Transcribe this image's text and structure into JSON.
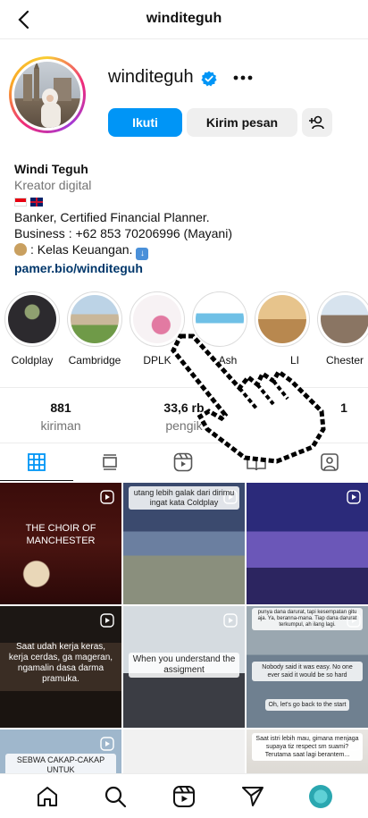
{
  "header": {
    "title": "winditeguh"
  },
  "profile": {
    "username": "winditeguh",
    "follow_label": "Ikuti",
    "message_label": "Kirim pesan",
    "name": "Windi Teguh",
    "category": "Kreator digital",
    "bio_line1": "Banker, Certified Financial Planner.",
    "bio_line2": "Business : +62 853 70206996 (Mayani)",
    "bio_line3": ": Kelas Keuangan.",
    "link": "pamer.bio/winditeguh"
  },
  "highlights": [
    {
      "label": "Coldplay"
    },
    {
      "label": "Cambridge"
    },
    {
      "label": "DPLK"
    },
    {
      "label": "Ash"
    },
    {
      "label": "LI"
    },
    {
      "label": "Chester"
    }
  ],
  "stats": {
    "posts_count": "881",
    "posts_label": "kiriman",
    "followers_count": "33,6 rb",
    "followers_label": "pengik",
    "following_count": "1"
  },
  "grid": {
    "cell1_text": "THE CHOIR OF MANCHESTER",
    "cell2_text": "utang lebih galak dari dirimu ingat kata Coldplay",
    "cell4_text": "Saat udah kerja keras, kerja cerdas, ga mageran, ngamalin dasa darma pramuka.",
    "cell5_text": "When you understand the assigment",
    "cell6_text_a": "punya dana darurat, tapi kesempatan gitu aja. Ya, beranna-mana. Tiap dana darurat terkumpul, ah ilang lagi.",
    "cell6_text_b": "Nobody said it was easy. No one ever said it would be so hard",
    "cell6_text_c": "Oh, let's go back to the start",
    "cell7_text": "SEBWA CAKAP-CAKAP UNTUK",
    "cell9_text": "Saat istri lebih mau, gimana menjaga supaya tiz respect sm suami? Terutama saat lagi berantem..."
  },
  "colors": {
    "accent": "#0095f6",
    "link": "#00376b",
    "muted": "#737373"
  }
}
